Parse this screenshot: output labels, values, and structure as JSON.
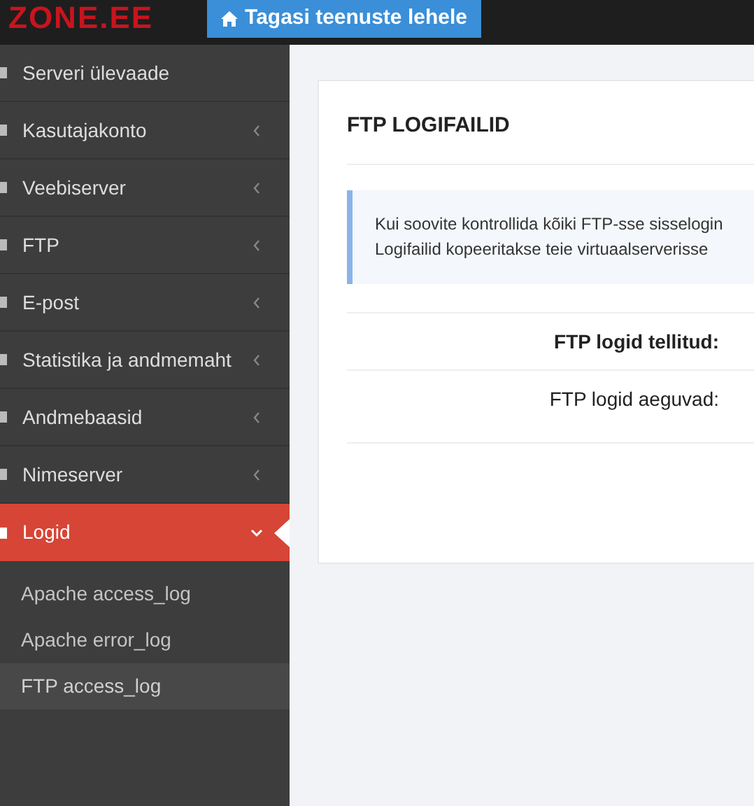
{
  "header": {
    "logo": "ZONE.EE",
    "back_button": "Tagasi teenuste lehele"
  },
  "sidebar": {
    "items": [
      {
        "label": "Serveri ülevaade",
        "kind": "link",
        "selected": false
      },
      {
        "label": "Kasutajakonto",
        "kind": "submenu",
        "selected": false
      },
      {
        "label": "Veebiserver",
        "kind": "submenu",
        "selected": false
      },
      {
        "label": "FTP",
        "kind": "submenu",
        "selected": false
      },
      {
        "label": "E-post",
        "kind": "submenu",
        "selected": false
      },
      {
        "label": "Statistika ja andmemaht",
        "kind": "submenu",
        "selected": false
      },
      {
        "label": "Andmebaasid",
        "kind": "submenu",
        "selected": false
      },
      {
        "label": "Nimeserver",
        "kind": "submenu",
        "selected": false
      },
      {
        "label": "Logid",
        "kind": "submenu",
        "selected": true,
        "expanded": true,
        "children": [
          {
            "label": "Apache access_log",
            "selected": false
          },
          {
            "label": "Apache error_log",
            "selected": false
          },
          {
            "label": "FTP access_log",
            "selected": true
          }
        ]
      }
    ]
  },
  "panel": {
    "title": "FTP LOGIFAILID",
    "info_lines": [
      "Kui soovite kontrollida kõiki FTP-sse sisselogin",
      "Logifailid kopeeritakse teie virtuaalserverisse"
    ],
    "rows": [
      {
        "label": "FTP logid tellitud:",
        "bold": true
      },
      {
        "label": "FTP logid aeguvad:",
        "bold": false
      }
    ]
  }
}
